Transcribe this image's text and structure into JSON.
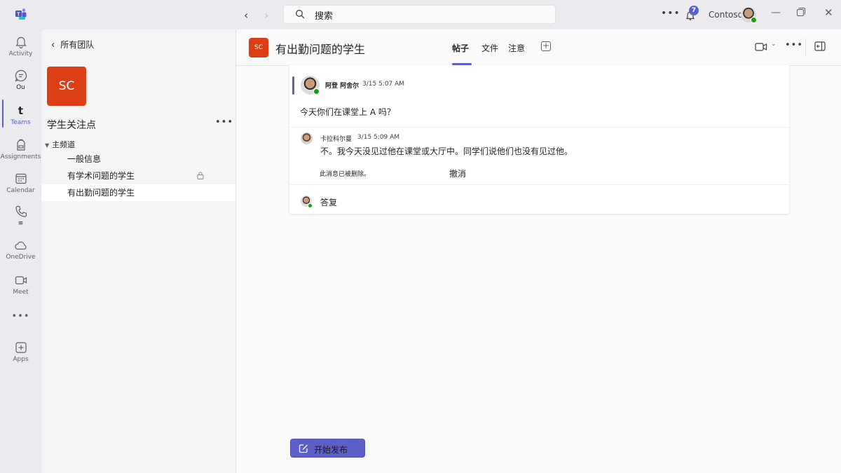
{
  "titlebar": {
    "app_icon": "teams-logo-icon",
    "search_placeholder": "搜索",
    "more_label": "•••",
    "notifications_count": "7",
    "org_name": "Contoso",
    "minimize": "—",
    "close": "✕",
    "back": "‹",
    "forward": "›"
  },
  "rail": {
    "items": [
      {
        "label": "Activity",
        "icon": "bell-icon"
      },
      {
        "label": "Ou",
        "icon": "chat-icon"
      },
      {
        "label": "Teams",
        "icon": "teams-icon",
        "glyph": "t",
        "active": true
      },
      {
        "label": "Assignments",
        "icon": "backpack-icon"
      },
      {
        "label": "Calendar",
        "icon": "calendar-icon"
      },
      {
        "label": "≡",
        "icon": "phone-icon"
      },
      {
        "label": "OneDrive",
        "icon": "cloud-icon"
      },
      {
        "label": "Meet",
        "icon": "video-icon"
      },
      {
        "label": "•••",
        "icon": "more-icon"
      },
      {
        "label": "Apps",
        "icon": "apps-icon"
      }
    ]
  },
  "team_panel": {
    "back_label": "所有团队",
    "team_initials": "SC",
    "team_name": "学生关注点",
    "team_more": "•••",
    "section": "主频道",
    "channels": [
      {
        "name": "一般信息",
        "locked": false,
        "active": false
      },
      {
        "name": "有学术问题的学生",
        "locked": true,
        "active": false
      },
      {
        "name": "有出勤问题的学生",
        "locked": false,
        "active": true
      }
    ]
  },
  "channel_header": {
    "initials": "SC",
    "title": "有出勤问题的学生",
    "tabs": [
      {
        "label": "帖子",
        "active": true
      },
      {
        "label": "文件",
        "active": false
      },
      {
        "label": "注意",
        "active": false
      }
    ],
    "more_label": "•••",
    "caret": "⌄",
    "colors": {
      "accent": "#5b5fc7",
      "team_tile": "#dc3e15"
    }
  },
  "thread": {
    "post": {
      "author": "阿登 阿舍尔",
      "time": "3/15 5:07 AM",
      "body": "今天你们在课堂上 A 吗？"
    },
    "reply": {
      "author": "卡拉科尔曼",
      "time": "3/15 5:09 AM",
      "body": "不。我今天没见过他在课堂或大厅中。同学们说他们也没有见过他。"
    },
    "deleted_note": "此消息已被删除。",
    "undo_label": "撤消",
    "reply_label": "答复"
  },
  "compose": {
    "new_post_label": "开始发布"
  }
}
